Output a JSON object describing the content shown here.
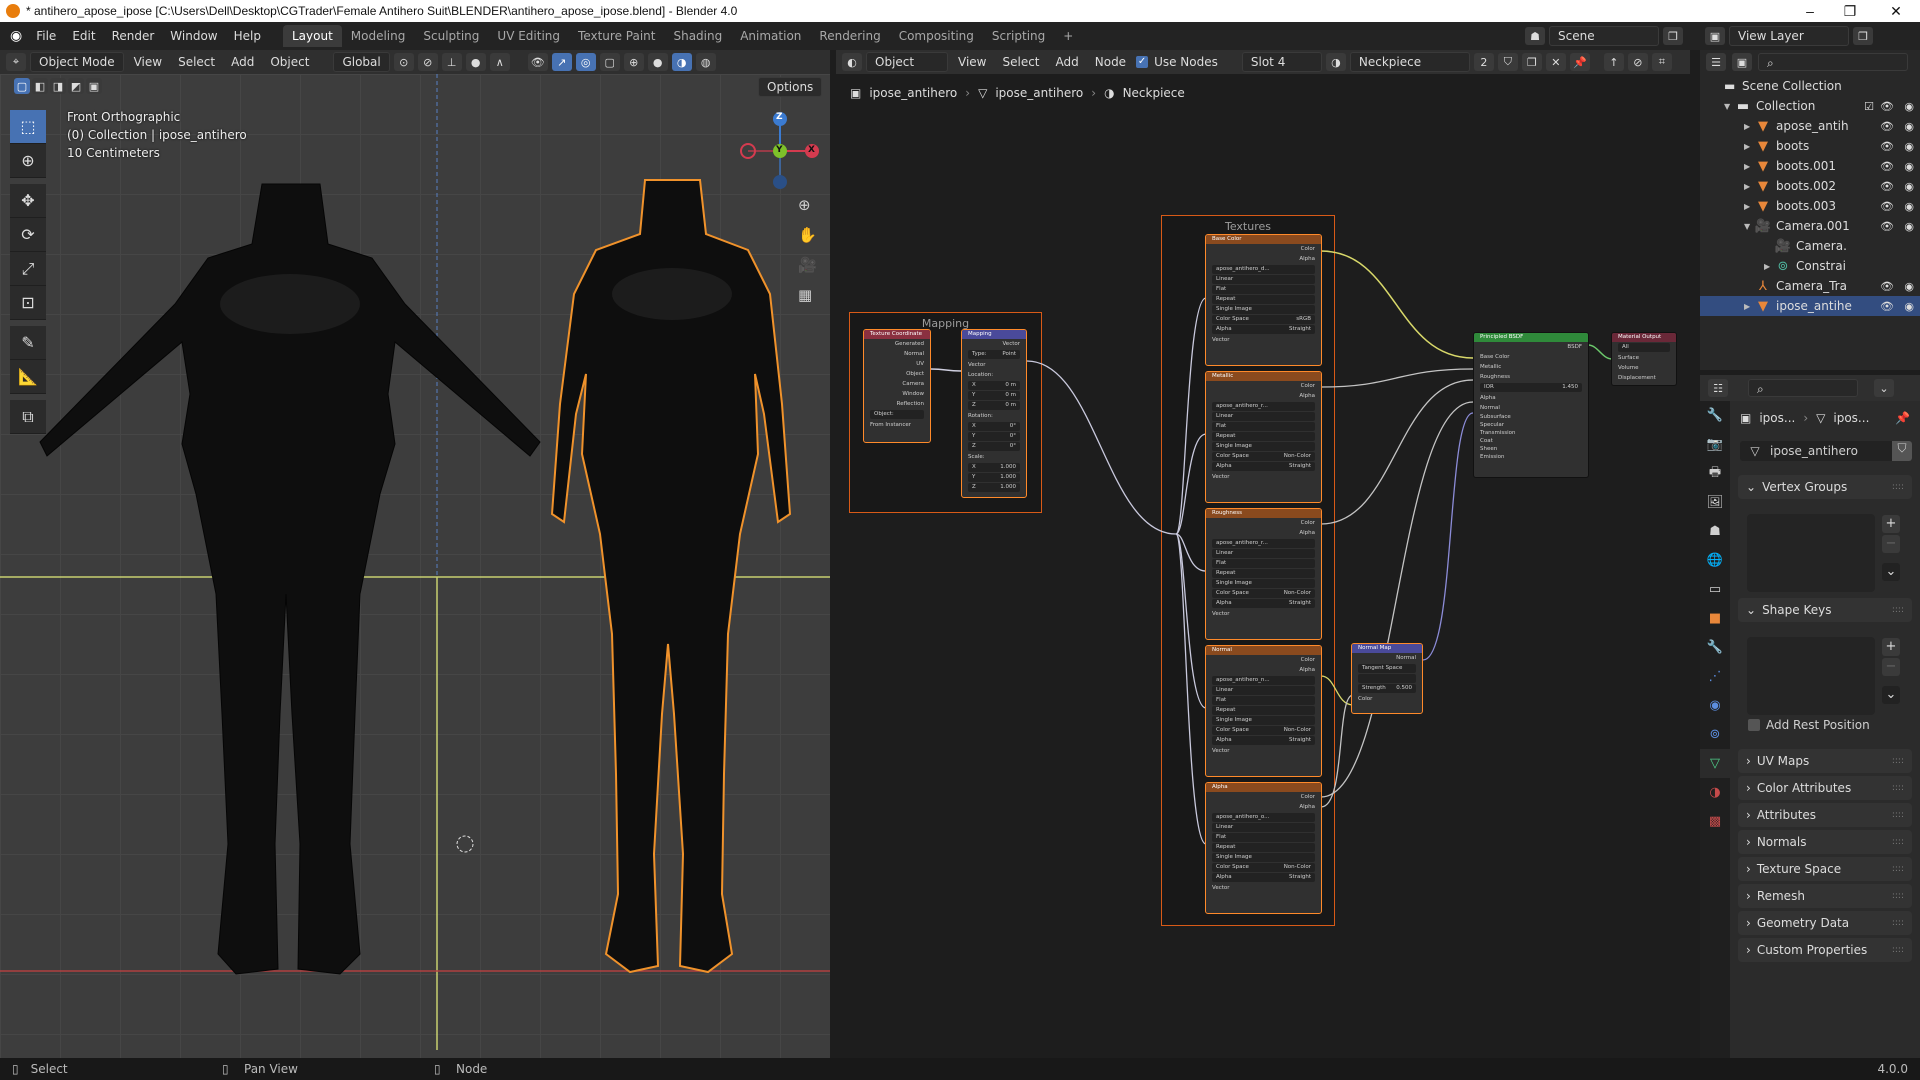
{
  "title_bar": {
    "title": "* antihero_apose_ipose [C:\\Users\\Dell\\Desktop\\CGTrader\\Female Antihero Suit\\BLENDER\\antihero_apose_ipose.blend] - Blender 4.0",
    "minimize": "–",
    "maximize": "❐",
    "close": "✕"
  },
  "menus": [
    "File",
    "Edit",
    "Render",
    "Window",
    "Help"
  ],
  "workspaces": [
    "Layout",
    "Modeling",
    "Sculpting",
    "UV Editing",
    "Texture Paint",
    "Shading",
    "Animation",
    "Rendering",
    "Compositing",
    "Scripting",
    "+"
  ],
  "scene": {
    "label": "Scene",
    "view_layer": "View Layer"
  },
  "viewport": {
    "mode": "Object Mode",
    "menus": [
      "View",
      "Select",
      "Add",
      "Object"
    ],
    "orientation": "Global",
    "options": "Options",
    "view_name": "Front Orthographic",
    "collection_info": "(0) Collection | ipose_antihero",
    "scale": "10 Centimeters",
    "gizmo": {
      "z": "Z",
      "y": "Y",
      "x": "X"
    }
  },
  "node_editor": {
    "type": "Object",
    "menus": [
      "View",
      "Select",
      "Add",
      "Node"
    ],
    "use_nodes": "Use Nodes",
    "slot": "Slot 4",
    "material": "Neckpiece",
    "users": "2",
    "breadcrumb": [
      "ipose_antihero",
      "ipose_antihero",
      "Neckpiece"
    ],
    "frames": {
      "mapping": "Mapping",
      "textures": "Textures"
    },
    "tex_coord": {
      "title": "Texture Coordinate",
      "outputs": [
        "Generated",
        "Normal",
        "UV",
        "Object",
        "Camera",
        "Window",
        "Reflection"
      ],
      "object_label": "Object:",
      "from_instancer": "From Instancer"
    },
    "mapping": {
      "title": "Mapping",
      "output": "Vector",
      "type_label": "Type:",
      "type": "Point",
      "input": "Vector",
      "location": "Location:",
      "loc": [
        [
          "X",
          "0 m"
        ],
        [
          "Y",
          "0 m"
        ],
        [
          "Z",
          "0 m"
        ]
      ],
      "rotation": "Rotation:",
      "rot": [
        [
          "X",
          "0°"
        ],
        [
          "Y",
          "0°"
        ],
        [
          "Z",
          "0°"
        ]
      ],
      "scale": "Scale:",
      "scl": [
        [
          "X",
          "1.000"
        ],
        [
          "Y",
          "1.000"
        ],
        [
          "Z",
          "1.000"
        ]
      ]
    },
    "textures": [
      {
        "title": "Base Color",
        "image": "apose_antihero_d...",
        "color_space": "sRGB",
        "alpha": "Straight"
      },
      {
        "title": "Metallic",
        "image": "apose_antihero_r...",
        "color_space": "Non-Color",
        "alpha": "Straight"
      },
      {
        "title": "Roughness",
        "image": "apose_antihero_r...",
        "color_space": "Non-Color",
        "alpha": "Straight"
      },
      {
        "title": "Normal",
        "image": "apose_antihero_n...",
        "color_space": "Non-Color",
        "alpha": "Straight"
      },
      {
        "title": "Alpha",
        "image": "apose_antihero_o...",
        "color_space": "Non-Color",
        "alpha": "Straight"
      }
    ],
    "tex_common": {
      "out_color": "Color",
      "out_alpha": "Alpha",
      "interp": "Linear",
      "proj": "Flat",
      "ext": "Repeat",
      "source": "Single Image",
      "cs_label": "Color Space",
      "alpha_label": "Alpha",
      "vector": "Vector"
    },
    "bsdf": {
      "title": "Principled BSDF",
      "output": "BSDF",
      "inputs": [
        "Base Color",
        "Metallic",
        "Roughness"
      ],
      "ior_label": "IOR",
      "ior": "1.450",
      "inputs2": [
        "Alpha",
        "Normal"
      ],
      "subpanels": [
        "Subsurface",
        "Specular",
        "Transmission",
        "Coat",
        "Sheen",
        "Emission"
      ]
    },
    "output": {
      "title": "Material Output",
      "target": "All",
      "inputs": [
        "Surface",
        "Volume",
        "Displacement"
      ]
    },
    "normal_map": {
      "title": "Normal Map",
      "output": "Normal",
      "space": "Tangent Space",
      "strength_label": "Strength",
      "strength": "0.500",
      "input": "Color"
    }
  },
  "outliner": {
    "root": "Scene Collection",
    "items": [
      {
        "name": "Collection",
        "depth": 0
      },
      {
        "name": "apose_antih",
        "depth": 1
      },
      {
        "name": "boots",
        "depth": 1
      },
      {
        "name": "boots.001",
        "depth": 1
      },
      {
        "name": "boots.002",
        "depth": 1
      },
      {
        "name": "boots.003",
        "depth": 1
      },
      {
        "name": "Camera.001",
        "depth": 1
      },
      {
        "name": "Camera.",
        "depth": 2
      },
      {
        "name": "Constrai",
        "depth": 2
      },
      {
        "name": "Camera_Tra",
        "depth": 1
      },
      {
        "name": "ipose_antihe",
        "depth": 1
      }
    ]
  },
  "properties": {
    "breadcrumb": [
      "ipos...",
      "ipos..."
    ],
    "mesh_name": "ipose_antihero",
    "vertex_groups": "Vertex Groups",
    "shape_keys": "Shape Keys",
    "add_rest_position": "Add Rest Position",
    "panels": [
      "UV Maps",
      "Color Attributes",
      "Attributes",
      "Normals",
      "Texture Space",
      "Remesh",
      "Geometry Data",
      "Custom Properties"
    ]
  },
  "status_bar": {
    "select": "Select",
    "pan": "Pan View",
    "node": "Node",
    "version": "4.0.0"
  }
}
